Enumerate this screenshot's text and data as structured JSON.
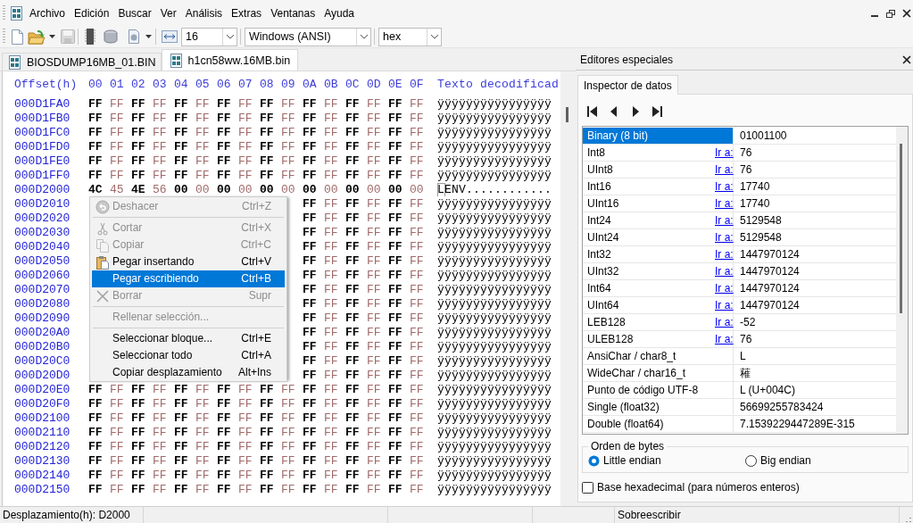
{
  "menu_bar": {
    "items": [
      "Archivo",
      "Edición",
      "Buscar",
      "Ver",
      "Análisis",
      "Extras",
      "Ventanas",
      "Ayuda"
    ]
  },
  "toolbar": {
    "bytes_per_row": "16",
    "charset": "Windows (ANSI)",
    "offset_base": "hex"
  },
  "tabs": [
    {
      "label": "BIOSDUMP16MB_01.BIN",
      "selected": false
    },
    {
      "label": "h1cn58ww.16MB.bin",
      "selected": true
    }
  ],
  "hex_view": {
    "header": {
      "offset": "Offset(h)",
      "columns": [
        "00",
        "01",
        "02",
        "03",
        "04",
        "05",
        "06",
        "07",
        "08",
        "09",
        "0A",
        "0B",
        "0C",
        "0D",
        "0E",
        "0F"
      ],
      "text": "Texto decodificad"
    },
    "rows": [
      {
        "offset": "000D1FA0",
        "bytes": [
          "FF",
          "FF",
          "FF",
          "FF",
          "FF",
          "FF",
          "FF",
          "FF",
          "FF",
          "FF",
          "FF",
          "FF",
          "FF",
          "FF",
          "FF",
          "FF"
        ],
        "text": "ÿÿÿÿÿÿÿÿÿÿÿÿÿÿÿÿ",
        "cursor": false
      },
      {
        "offset": "000D1FB0",
        "bytes": [
          "FF",
          "FF",
          "FF",
          "FF",
          "FF",
          "FF",
          "FF",
          "FF",
          "FF",
          "FF",
          "FF",
          "FF",
          "FF",
          "FF",
          "FF",
          "FF"
        ],
        "text": "ÿÿÿÿÿÿÿÿÿÿÿÿÿÿÿÿ",
        "cursor": false
      },
      {
        "offset": "000D1FC0",
        "bytes": [
          "FF",
          "FF",
          "FF",
          "FF",
          "FF",
          "FF",
          "FF",
          "FF",
          "FF",
          "FF",
          "FF",
          "FF",
          "FF",
          "FF",
          "FF",
          "FF"
        ],
        "text": "ÿÿÿÿÿÿÿÿÿÿÿÿÿÿÿÿ",
        "cursor": false
      },
      {
        "offset": "000D1FD0",
        "bytes": [
          "FF",
          "FF",
          "FF",
          "FF",
          "FF",
          "FF",
          "FF",
          "FF",
          "FF",
          "FF",
          "FF",
          "FF",
          "FF",
          "FF",
          "FF",
          "FF"
        ],
        "text": "ÿÿÿÿÿÿÿÿÿÿÿÿÿÿÿÿ",
        "cursor": false
      },
      {
        "offset": "000D1FE0",
        "bytes": [
          "FF",
          "FF",
          "FF",
          "FF",
          "FF",
          "FF",
          "FF",
          "FF",
          "FF",
          "FF",
          "FF",
          "FF",
          "FF",
          "FF",
          "FF",
          "FF"
        ],
        "text": "ÿÿÿÿÿÿÿÿÿÿÿÿÿÿÿÿ",
        "cursor": false
      },
      {
        "offset": "000D1FF0",
        "bytes": [
          "FF",
          "FF",
          "FF",
          "FF",
          "FF",
          "FF",
          "FF",
          "FF",
          "FF",
          "FF",
          "FF",
          "FF",
          "FF",
          "FF",
          "FF",
          "FF"
        ],
        "text": "ÿÿÿÿÿÿÿÿÿÿÿÿÿÿÿÿ",
        "cursor": false
      },
      {
        "offset": "000D2000",
        "bytes": [
          "4C",
          "45",
          "4E",
          "56",
          "00",
          "00",
          "00",
          "00",
          "00",
          "00",
          "00",
          "00",
          "00",
          "00",
          "00",
          "00"
        ],
        "text": "LENV............",
        "cursor": true
      },
      {
        "offset": "000D2010",
        "bytes": [
          "FF",
          "FF",
          "FF",
          "FF",
          "FF",
          "FF"
        ],
        "text": "ÿÿÿÿÿÿÿÿÿÿÿÿÿÿÿÿ",
        "cursor": false
      },
      {
        "offset": "000D2020",
        "bytes": [
          "FF",
          "FF",
          "FF",
          "FF",
          "FF",
          "FF"
        ],
        "text": "ÿÿÿÿÿÿÿÿÿÿÿÿÿÿÿÿ",
        "cursor": false
      },
      {
        "offset": "000D2030",
        "bytes": [
          "FF",
          "FF",
          "FF",
          "FF",
          "FF",
          "FF"
        ],
        "text": "ÿÿÿÿÿÿÿÿÿÿÿÿÿÿÿÿ",
        "cursor": false
      },
      {
        "offset": "000D2040",
        "bytes": [
          "FF",
          "FF",
          "FF",
          "FF",
          "FF",
          "FF"
        ],
        "text": "ÿÿÿÿÿÿÿÿÿÿÿÿÿÿÿÿ",
        "cursor": false
      },
      {
        "offset": "000D2050",
        "bytes": [
          "FF",
          "FF",
          "FF",
          "FF",
          "FF",
          "FF"
        ],
        "text": "ÿÿÿÿÿÿÿÿÿÿÿÿÿÿÿÿ",
        "cursor": false
      },
      {
        "offset": "000D2060",
        "bytes": [
          "FF",
          "FF",
          "FF",
          "FF",
          "FF",
          "FF"
        ],
        "text": "ÿÿÿÿÿÿÿÿÿÿÿÿÿÿÿÿ",
        "cursor": false
      },
      {
        "offset": "000D2070",
        "bytes": [
          "FF",
          "FF",
          "FF",
          "FF",
          "FF",
          "FF"
        ],
        "text": "ÿÿÿÿÿÿÿÿÿÿÿÿÿÿÿÿ",
        "cursor": false
      },
      {
        "offset": "000D2080",
        "bytes": [
          "FF",
          "FF",
          "FF",
          "FF",
          "FF",
          "FF"
        ],
        "text": "ÿÿÿÿÿÿÿÿÿÿÿÿÿÿÿÿ",
        "cursor": false
      },
      {
        "offset": "000D2090",
        "bytes": [
          "FF",
          "FF",
          "FF",
          "FF",
          "FF",
          "FF"
        ],
        "text": "ÿÿÿÿÿÿÿÿÿÿÿÿÿÿÿÿ",
        "cursor": false
      },
      {
        "offset": "000D20A0",
        "bytes": [
          "FF",
          "FF",
          "FF",
          "FF",
          "FF",
          "FF"
        ],
        "text": "ÿÿÿÿÿÿÿÿÿÿÿÿÿÿÿÿ",
        "cursor": false
      },
      {
        "offset": "000D20B0",
        "bytes": [
          "FF",
          "FF",
          "FF",
          "FF",
          "FF",
          "FF"
        ],
        "text": "ÿÿÿÿÿÿÿÿÿÿÿÿÿÿÿÿ",
        "cursor": false
      },
      {
        "offset": "000D20C0",
        "bytes": [
          "FF",
          "FF",
          "FF",
          "FF",
          "FF",
          "FF"
        ],
        "text": "ÿÿÿÿÿÿÿÿÿÿÿÿÿÿÿÿ",
        "cursor": false
      },
      {
        "offset": "000D20D0",
        "bytes": [
          "FF",
          "FF",
          "FF",
          "FF",
          "FF",
          "FF"
        ],
        "text": "ÿÿÿÿÿÿÿÿÿÿÿÿÿÿÿÿ",
        "cursor": false
      },
      {
        "offset": "000D20E0",
        "bytes": [
          "FF",
          "FF",
          "FF",
          "FF",
          "FF",
          "FF",
          "FF",
          "FF",
          "FF",
          "FF",
          "FF",
          "FF",
          "FF",
          "FF",
          "FF",
          "FF"
        ],
        "text": "ÿÿÿÿÿÿÿÿÿÿÿÿÿÿÿÿ",
        "cursor": false
      },
      {
        "offset": "000D20F0",
        "bytes": [
          "FF",
          "FF",
          "FF",
          "FF",
          "FF",
          "FF",
          "FF",
          "FF",
          "FF",
          "FF",
          "FF",
          "FF",
          "FF",
          "FF",
          "FF",
          "FF"
        ],
        "text": "ÿÿÿÿÿÿÿÿÿÿÿÿÿÿÿÿ",
        "cursor": false
      },
      {
        "offset": "000D2100",
        "bytes": [
          "FF",
          "FF",
          "FF",
          "FF",
          "FF",
          "FF",
          "FF",
          "FF",
          "FF",
          "FF",
          "FF",
          "FF",
          "FF",
          "FF",
          "FF",
          "FF"
        ],
        "text": "ÿÿÿÿÿÿÿÿÿÿÿÿÿÿÿÿ",
        "cursor": false
      },
      {
        "offset": "000D2110",
        "bytes": [
          "FF",
          "FF",
          "FF",
          "FF",
          "FF",
          "FF",
          "FF",
          "FF",
          "FF",
          "FF",
          "FF",
          "FF",
          "FF",
          "FF",
          "FF",
          "FF"
        ],
        "text": "ÿÿÿÿÿÿÿÿÿÿÿÿÿÿÿÿ",
        "cursor": false
      },
      {
        "offset": "000D2120",
        "bytes": [
          "FF",
          "FF",
          "FF",
          "FF",
          "FF",
          "FF",
          "FF",
          "FF",
          "FF",
          "FF",
          "FF",
          "FF",
          "FF",
          "FF",
          "FF",
          "FF"
        ],
        "text": "ÿÿÿÿÿÿÿÿÿÿÿÿÿÿÿÿ",
        "cursor": false
      },
      {
        "offset": "000D2130",
        "bytes": [
          "FF",
          "FF",
          "FF",
          "FF",
          "FF",
          "FF",
          "FF",
          "FF",
          "FF",
          "FF",
          "FF",
          "FF",
          "FF",
          "FF",
          "FF",
          "FF"
        ],
        "text": "ÿÿÿÿÿÿÿÿÿÿÿÿÿÿÿÿ",
        "cursor": false
      },
      {
        "offset": "000D2140",
        "bytes": [
          "FF",
          "FF",
          "FF",
          "FF",
          "FF",
          "FF",
          "FF",
          "FF",
          "FF",
          "FF",
          "FF",
          "FF",
          "FF",
          "FF",
          "FF",
          "FF"
        ],
        "text": "ÿÿÿÿÿÿÿÿÿÿÿÿÿÿÿÿ",
        "cursor": false
      },
      {
        "offset": "000D2150",
        "bytes": [
          "FF",
          "FF",
          "FF",
          "FF",
          "FF",
          "FF",
          "FF",
          "FF",
          "FF",
          "FF",
          "FF",
          "FF",
          "FF",
          "FF",
          "FF",
          "FF"
        ],
        "text": "ÿÿÿÿÿÿÿÿÿÿÿÿÿÿÿÿ",
        "cursor": false
      }
    ]
  },
  "context_menu": {
    "items": [
      {
        "kind": "item",
        "label": "Deshacer",
        "shortcut": "Ctrl+Z",
        "disabled": true,
        "selected": false
      },
      {
        "kind": "separator"
      },
      {
        "kind": "item",
        "label": "Cortar",
        "shortcut": "Ctrl+X",
        "disabled": true,
        "selected": false
      },
      {
        "kind": "item",
        "label": "Copiar",
        "shortcut": "Ctrl+C",
        "disabled": true,
        "selected": false
      },
      {
        "kind": "item",
        "label": "Pegar insertando",
        "shortcut": "Ctrl+V",
        "disabled": false,
        "selected": false
      },
      {
        "kind": "item",
        "label": "Pegar escribiendo",
        "shortcut": "Ctrl+B",
        "disabled": false,
        "selected": true
      },
      {
        "kind": "item",
        "label": "Borrar",
        "shortcut": "Supr",
        "disabled": true,
        "selected": false
      },
      {
        "kind": "separator"
      },
      {
        "kind": "item",
        "label": "Rellenar selección...",
        "disabled": true,
        "selected": false
      },
      {
        "kind": "separator"
      },
      {
        "kind": "item",
        "label": "Seleccionar bloque...",
        "shortcut": "Ctrl+E",
        "disabled": false,
        "selected": false
      },
      {
        "kind": "item",
        "label": "Seleccionar todo",
        "shortcut": "Ctrl+A",
        "disabled": false,
        "selected": false
      },
      {
        "kind": "item",
        "label": "Copiar desplazamiento",
        "shortcut": "Alt+Ins",
        "disabled": false,
        "selected": false
      }
    ]
  },
  "special_editors": {
    "title": "Editores especiales",
    "tabs": [
      {
        "label": "Inspector de datos",
        "selected": true
      }
    ],
    "rows": [
      {
        "label": "Binary (8 bit)",
        "value": "01001100",
        "selected": true
      },
      {
        "label": "Int8",
        "link": "Ir a:",
        "value": "76",
        "selected": false
      },
      {
        "label": "UInt8",
        "link": "Ir a:",
        "value": "76",
        "selected": false
      },
      {
        "label": "Int16",
        "link": "Ir a:",
        "value": "17740",
        "selected": false
      },
      {
        "label": "UInt16",
        "link": "Ir a:",
        "value": "17740",
        "selected": false
      },
      {
        "label": "Int24",
        "link": "Ir a:",
        "value": "5129548",
        "selected": false
      },
      {
        "label": "UInt24",
        "link": "Ir a:",
        "value": "5129548",
        "selected": false
      },
      {
        "label": "Int32",
        "link": "Ir a:",
        "value": "1447970124",
        "selected": false
      },
      {
        "label": "UInt32",
        "link": "Ir a:",
        "value": "1447970124",
        "selected": false
      },
      {
        "label": "Int64",
        "link": "Ir a:",
        "value": "1447970124",
        "selected": false
      },
      {
        "label": "UInt64",
        "link": "Ir a:",
        "value": "1447970124",
        "selected": false
      },
      {
        "label": "LEB128",
        "link": "Ir a:",
        "value": "-52",
        "selected": false
      },
      {
        "label": "ULEB128",
        "link": "Ir a:",
        "value": "76",
        "selected": false
      },
      {
        "label": "AnsiChar / char8_t",
        "value": "L",
        "selected": false
      },
      {
        "label": "WideChar / char16_t",
        "value": "䕌",
        "selected": false
      },
      {
        "label": "Punto de código UTF-8",
        "value": "L (U+004C)",
        "selected": false
      },
      {
        "label": "Single (float32)",
        "value": "56699255783424",
        "selected": false
      },
      {
        "label": "Double (float64)",
        "value": "7.1539229447289E-315",
        "selected": false
      }
    ],
    "byte_order": {
      "title": "Orden de bytes",
      "options": [
        {
          "label": "Little endian",
          "selected": true
        },
        {
          "label": "Big endian",
          "selected": false
        }
      ]
    },
    "hex_base": {
      "label": "Base hexadecimal (para números enteros)",
      "checked": false
    }
  },
  "status_bar": {
    "offset": "Desplazamiento(h): D2000",
    "mode": "Sobreescribir"
  }
}
